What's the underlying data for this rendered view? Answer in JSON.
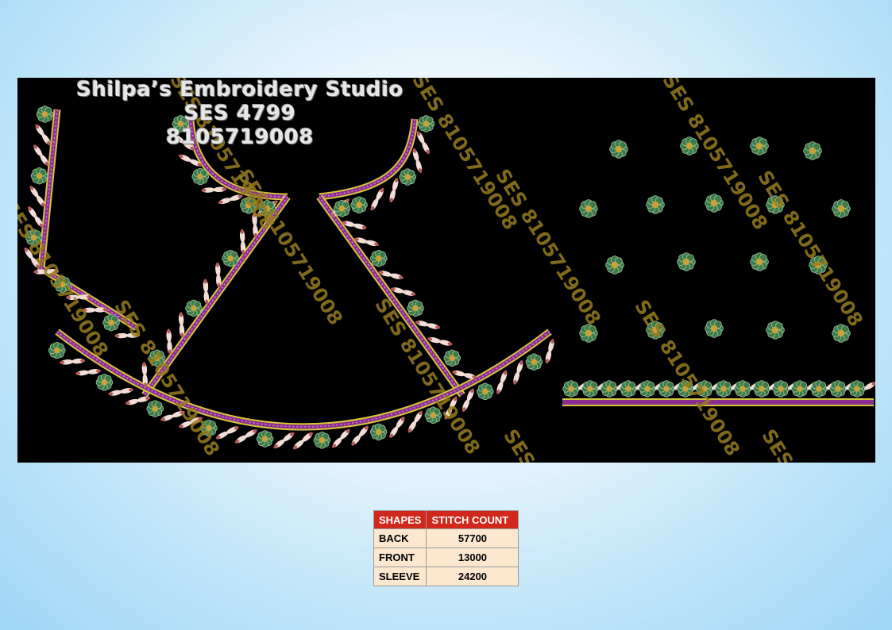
{
  "design": {
    "studio_name": "Shilpa’s Embroidery Studio",
    "design_code": "SES 4799",
    "phone": "8105719008",
    "watermark": "SES 8105719008",
    "colors": {
      "background": "#000000",
      "flower_petal": "#3d7a4a",
      "flower_center": "#c9a33a",
      "leaf": "#f2dcd6",
      "leaf_tip": "#b85a5a",
      "border_purple": "#8a2f8f",
      "border_gold": "#d6c63a"
    }
  },
  "table": {
    "headers": [
      "SHAPES",
      "STITCH COUNT"
    ],
    "rows": [
      {
        "shape": "BACK",
        "count": "57700"
      },
      {
        "shape": "FRONT",
        "count": "13000"
      },
      {
        "shape": "SLEEVE",
        "count": "24200"
      }
    ]
  }
}
